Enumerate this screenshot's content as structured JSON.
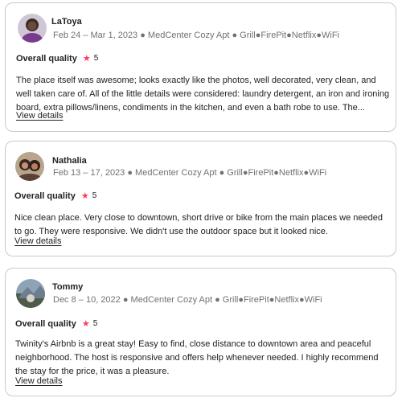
{
  "reviews": [
    {
      "name": "LaToya",
      "meta": "Feb 24 – Mar 1, 2023 ● MedCenter Cozy Apt ● Grill●FirePit●Netflix●WiFi",
      "quality_label": "Overall quality",
      "rating": "5",
      "text": "The place itself was awesome; looks exactly like the photos, well decorated, very clean, and well taken care of. All of the little details were considered: laundry detergent, an iron and ironing board, extra pillows/linens, condiments in the kitchen, and even a bath robe to use. The...",
      "details_label": "View details"
    },
    {
      "name": "Nathalia",
      "meta": "Feb 13 – 17, 2023 ● MedCenter Cozy Apt ● Grill●FirePit●Netflix●WiFi",
      "quality_label": "Overall quality",
      "rating": "5",
      "text": "Nice clean place. Very close to downtown, short drive or bike from the main places we needed to go. They were responsive. We didn't use the outdoor space but it looked nice.",
      "details_label": "View details"
    },
    {
      "name": "Tommy",
      "meta": "Dec 8 – 10, 2022 ● MedCenter Cozy Apt ● Grill●FirePit●Netflix●WiFi",
      "quality_label": "Overall quality",
      "rating": "5",
      "text": "Twinity's Airbnb is a great stay! Easy to find, close distance to downtown area and peaceful neighborhood. The host is responsive and offers help whenever needed. I highly recommend the stay for the price, it was a pleasure.",
      "details_label": "View details"
    }
  ],
  "colors": {
    "star": "#ff385c",
    "meta": "#717171",
    "border": "#c9c9c9"
  }
}
